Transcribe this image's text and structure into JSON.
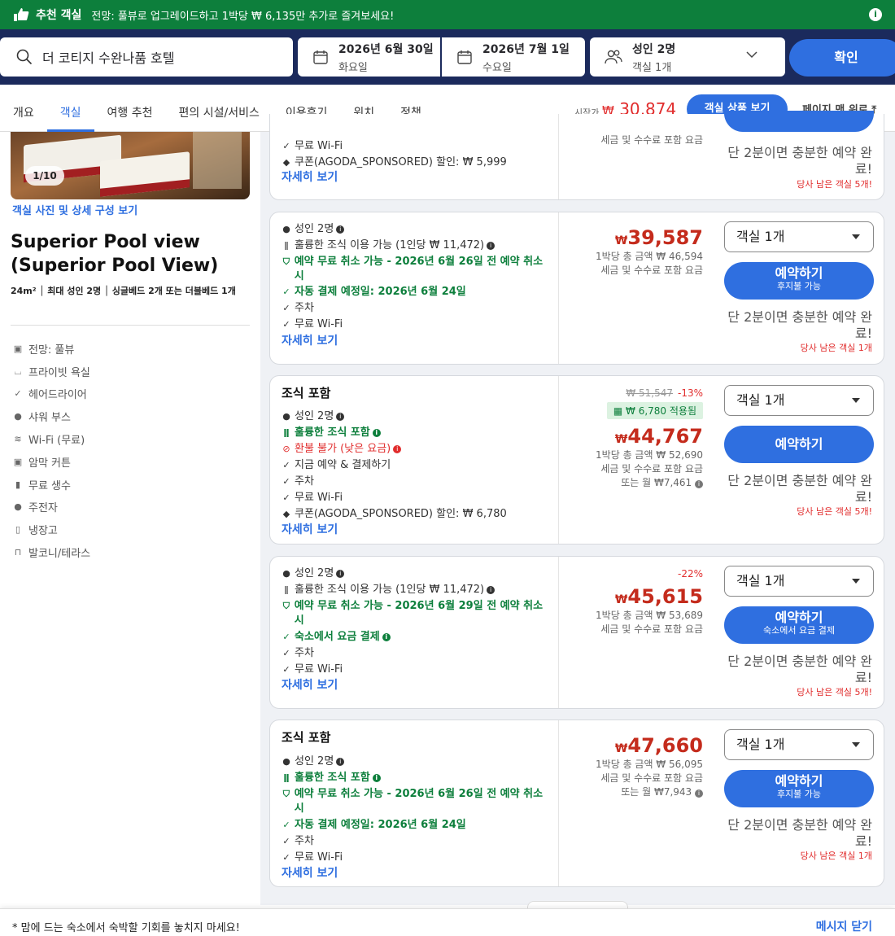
{
  "promo": {
    "title": "추천 객실",
    "message": "전망: 풀뷰로 업그레이드하고 1박당 ₩ 6,135만 추가로 즐겨보세요!"
  },
  "search": {
    "destination": "더 코티지 수완나품 호텔",
    "checkin_date": "2026년 6월 30일",
    "checkin_day": "화요일",
    "checkout_date": "2026년 7월 1일",
    "checkout_day": "수요일",
    "guests": "성인 2명",
    "rooms": "객실 1개",
    "confirm": "확인"
  },
  "nav": {
    "tabs": [
      "개요",
      "객실",
      "여행 추천",
      "편의 시설/서비스",
      "이용후기",
      "위치",
      "정책"
    ],
    "from_label": "시작가",
    "from_currency": "₩",
    "from_price": "30,874",
    "room_button": "객실 상품 보기",
    "top_link": "페이지 맨 위로"
  },
  "room": {
    "photo_count": "1/10",
    "photo_link": "객실 사진 및 상세 구성 보기",
    "title": "Superior Pool view (Superior Pool View)",
    "size": "24m²",
    "max": "최대 성인 2명",
    "bed": "싱글베드 2개 또는 더블베드 1개",
    "amenities": [
      "전망: 풀뷰",
      "프라이빗 욕실",
      "헤어드라이어",
      "샤워 부스",
      "Wi-Fi (무료)",
      "암막 커튼",
      "무료 생수",
      "주전자",
      "냉장고",
      "발코니/테라스"
    ]
  },
  "card0": {
    "f1": "무료 Wi-Fi",
    "f2": "쿠폰(AGODA_SPONSORED) 할인: ₩ 5,999",
    "more": "자세히 보기",
    "tax": "세금 및 수수료 포함 요금",
    "urgency": "단 2분이면 충분한 예약 완료!",
    "left": "당사 남은 객실 5개!"
  },
  "card1": {
    "adults": "성인 2명",
    "breakfast": "훌륭한 조식 이용 가능 (1인당 ₩ 11,472)",
    "cancel": "예약 무료 취소 가능 - 2026년 6월 26일 전 예약 취소 시",
    "autopay": "자동 결제 예정일: 2026년 6월 24일",
    "parking": "주차",
    "wifi": "무료 Wi-Fi",
    "more": "자세히 보기",
    "currency": "₩",
    "price": "39,587",
    "total": "1박당 총 금액 ₩ 46,594",
    "tax": "세금 및 수수료 포함 요금",
    "select": "객실 1개",
    "book": "예약하기",
    "book_sub": "후지불 가능",
    "urgency": "단 2분이면 충분한 예약 완료!",
    "left": "당사 남은 객실 1개"
  },
  "card2": {
    "category": "조식 포함",
    "adults": "성인 2명",
    "breakfast": "훌륭한 조식 포함",
    "nonrefund": "환불 불가 (낮은 요금)",
    "paynow": "지금 예약 & 결제하기",
    "parking": "주차",
    "wifi": "무료 Wi-Fi",
    "coupon": "쿠폰(AGODA_SPONSORED) 할인: ₩ 6,780",
    "more": "자세히 보기",
    "original": "₩ 51,547",
    "discount": "-13%",
    "coupon_applied": "₩ 6,780 적용됨",
    "currency": "₩",
    "price": "44,767",
    "total": "1박당 총 금액 ₩ 52,690",
    "tax": "세금 및 수수료 포함 요금",
    "monthly": "또는 월 ₩7,461",
    "select": "객실 1개",
    "book": "예약하기",
    "urgency": "단 2분이면 충분한 예약 완료!",
    "left": "당사 남은 객실 5개!"
  },
  "card3": {
    "adults": "성인 2명",
    "breakfast": "훌륭한 조식 이용 가능 (1인당 ₩ 11,472)",
    "cancel": "예약 무료 취소 가능 - 2026년 6월 29일 전 예약 취소 시",
    "payathotel": "숙소에서 요금 결제",
    "parking": "주차",
    "wifi": "무료 Wi-Fi",
    "more": "자세히 보기",
    "discount": "-22%",
    "currency": "₩",
    "price": "45,615",
    "total": "1박당 총 금액 ₩ 53,689",
    "tax": "세금 및 수수료 포함 요금",
    "select": "객실 1개",
    "book": "예약하기",
    "book_sub": "숙소에서 요금 결제",
    "urgency": "단 2분이면 충분한 예약 완료!",
    "left": "당사 남은 객실 5개!"
  },
  "card4": {
    "category": "조식 포함",
    "adults": "성인 2명",
    "breakfast": "훌륭한 조식 포함",
    "cancel": "예약 무료 취소 가능 - 2026년 6월 26일 전 예약 취소 시",
    "autopay": "자동 결제 예정일: 2026년 6월 24일",
    "parking": "주차",
    "wifi": "무료 Wi-Fi",
    "more": "자세히 보기",
    "currency": "₩",
    "price": "47,660",
    "total": "1박당 총 금액 ₩ 56,095",
    "tax": "세금 및 수수료 포함 요금",
    "monthly": "또는 월 ₩7,943",
    "select": "객실 1개",
    "book": "예약하기",
    "book_sub": "후지불 가능",
    "urgency": "단 2분이면 충분한 예약 완료!",
    "left": "당사 남은 객실 1개"
  },
  "footer": {
    "text": "* 맘에 드는 숙소에서 숙박할 기회를 놓치지 마세요!",
    "close": "메시지 닫기"
  }
}
